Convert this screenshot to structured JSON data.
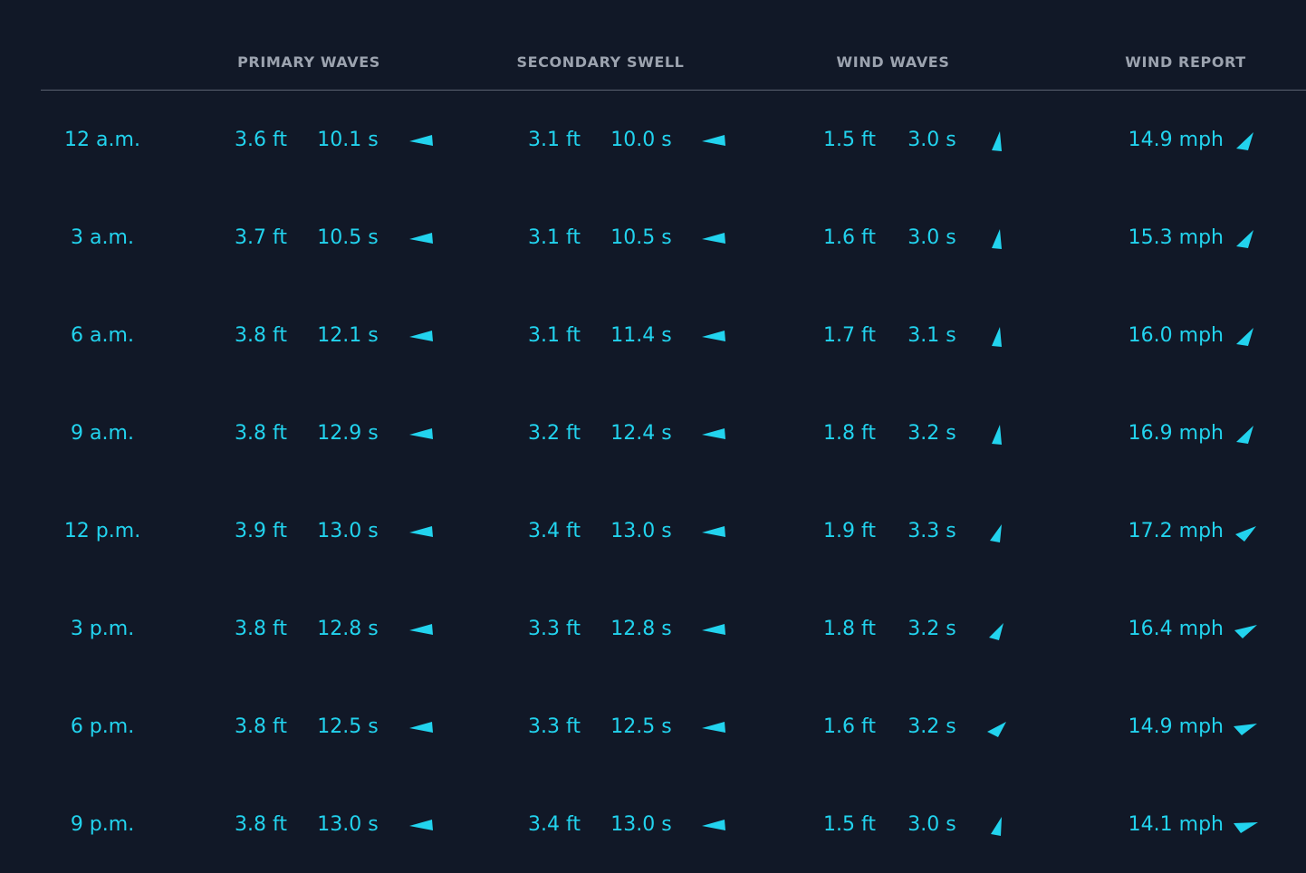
{
  "colors": {
    "background": "#111827",
    "accent": "#22d3ee",
    "header_text": "#9ca3af"
  },
  "header": {
    "primary_waves": "PRIMARY WAVES",
    "secondary_swell": "SECONDARY SWELL",
    "wind_waves": "WIND WAVES",
    "wind_report": "WIND REPORT"
  },
  "rows": [
    {
      "time": "12 a.m.",
      "p_h": "3.6 ft",
      "p_t": "10.1 s",
      "s_h": "3.1 ft",
      "s_t": "10.0 s",
      "w_h": "1.5 ft",
      "w_t": "3.0 s",
      "wind": "14.9 mph",
      "p_icon": "direction-arrow-icon",
      "s_icon": "direction-arrow-icon",
      "w_icon": "direction-arrow-icon",
      "wr_icon": "direction-arrow-icon"
    },
    {
      "time": "3 a.m.",
      "p_h": "3.7 ft",
      "p_t": "10.5 s",
      "s_h": "3.1 ft",
      "s_t": "10.5 s",
      "w_h": "1.6 ft",
      "w_t": "3.0 s",
      "wind": "15.3 mph"
    },
    {
      "time": "6 a.m.",
      "p_h": "3.8 ft",
      "p_t": "12.1 s",
      "s_h": "3.1 ft",
      "s_t": "11.4 s",
      "w_h": "1.7 ft",
      "w_t": "3.1 s",
      "wind": "16.0 mph"
    },
    {
      "time": "9 a.m.",
      "p_h": "3.8 ft",
      "p_t": "12.9 s",
      "s_h": "3.2 ft",
      "s_t": "12.4 s",
      "w_h": "1.8 ft",
      "w_t": "3.2 s",
      "wind": "16.9 mph"
    },
    {
      "time": "12 p.m.",
      "p_h": "3.9 ft",
      "p_t": "13.0 s",
      "s_h": "3.4 ft",
      "s_t": "13.0 s",
      "w_h": "1.9 ft",
      "w_t": "3.3 s",
      "wind": "17.2 mph"
    },
    {
      "time": "3 p.m.",
      "p_h": "3.8 ft",
      "p_t": "12.8 s",
      "s_h": "3.3 ft",
      "s_t": "12.8 s",
      "w_h": "1.8 ft",
      "w_t": "3.2 s",
      "wind": "16.4 mph"
    },
    {
      "time": "6 p.m.",
      "p_h": "3.8 ft",
      "p_t": "12.5 s",
      "s_h": "3.3 ft",
      "s_t": "12.5 s",
      "w_h": "1.6 ft",
      "w_t": "3.2 s",
      "wind": "14.9 mph"
    },
    {
      "time": "9 p.m.",
      "p_h": "3.8 ft",
      "p_t": "13.0 s",
      "s_h": "3.4 ft",
      "s_t": "13.0 s",
      "w_h": "1.5 ft",
      "w_t": "3.0 s",
      "wind": "14.1 mph"
    }
  ]
}
